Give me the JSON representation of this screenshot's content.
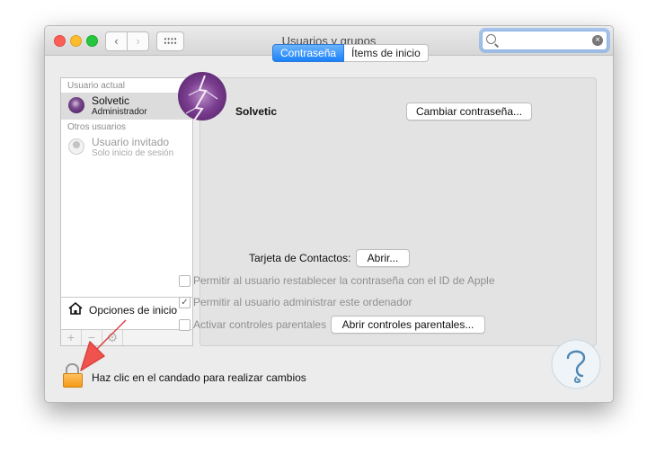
{
  "window": {
    "title": "Usuarios y grupos",
    "search_placeholder": ""
  },
  "sidebar": {
    "current_header": "Usuario actual",
    "current_user": {
      "name": "Solvetic",
      "role": "Administrador"
    },
    "other_header": "Otros usuarios",
    "other_users": [
      {
        "name": "Usuario invitado",
        "role": "Solo inicio de sesión"
      }
    ],
    "login_options": "Opciones de inicio",
    "tools": [
      "+",
      "−",
      "⚙"
    ]
  },
  "main": {
    "tabs": [
      {
        "label": "Contraseña",
        "active": true
      },
      {
        "label": "Ítems de inicio",
        "active": false
      }
    ],
    "user_name": "Solvetic",
    "change_password": "Cambiar contraseña...",
    "contacts_label": "Tarjeta de Contactos:",
    "open_button": "Abrir...",
    "checkboxes": [
      {
        "label": "Permitir al usuario restablecer la contraseña con el ID de Apple",
        "checked": false
      },
      {
        "label": "Permitir al usuario administrar este ordenador",
        "checked": true
      },
      {
        "label": "Activar controles parentales",
        "checked": false
      }
    ],
    "parental_button": "Abrir controles parentales..."
  },
  "footer": {
    "lock_text": "Haz clic en el candado para realizar cambios"
  },
  "colors": {
    "accent": "#1a82fb",
    "lock": "#f59a19",
    "arrow": "#f0524e"
  }
}
